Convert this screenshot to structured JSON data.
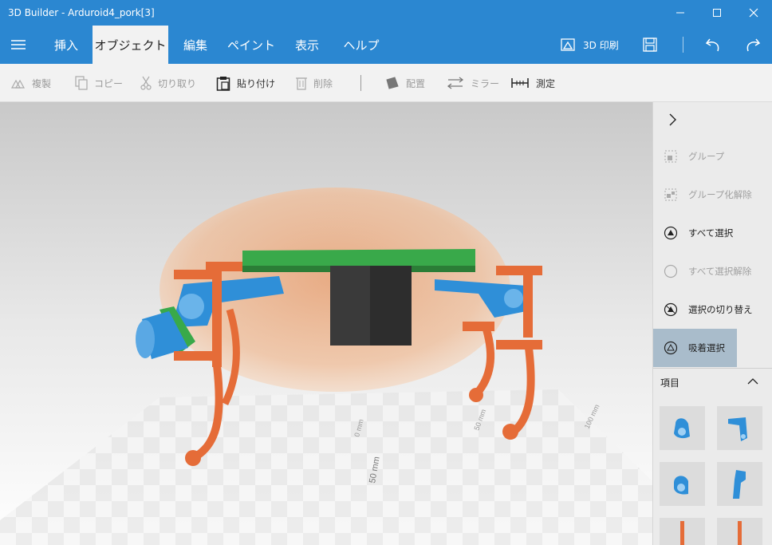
{
  "window": {
    "title": "3D Builder - Arduroid4_pork[3]"
  },
  "menu": {
    "tabs": [
      {
        "label": "挿入"
      },
      {
        "label": "オブジェクト"
      },
      {
        "label": "編集"
      },
      {
        "label": "ペイント"
      },
      {
        "label": "表示"
      },
      {
        "label": "ヘルプ"
      }
    ],
    "active_tab": "オブジェクト",
    "print_label": "3D 印刷"
  },
  "toolbar": {
    "duplicate": "複製",
    "copy": "コピー",
    "cut": "切り取り",
    "paste": "貼り付け",
    "delete": "削除",
    "arrange": "配置",
    "mirror": "ミラー",
    "measure": "測定"
  },
  "viewport": {
    "ruler_label": "50 mm",
    "axis_label_a": "0 mm",
    "axis_label_b": "50 mm",
    "axis_label_c": "100 mm"
  },
  "side_panel": {
    "group": "グループ",
    "ungroup": "グループ化解除",
    "select_all": "すべて選択",
    "deselect_all": "すべて選択解除",
    "invert_selection": "選択の切り替え",
    "snap_select": "吸着選択",
    "items_header": "項目"
  },
  "colors": {
    "accent": "#2b87d1",
    "part_orange": "#e56c38",
    "part_blue": "#2f8fd8",
    "part_green": "#39a94a",
    "body_shell": "#f3c8a6",
    "active_panel": "#a9bccb"
  }
}
